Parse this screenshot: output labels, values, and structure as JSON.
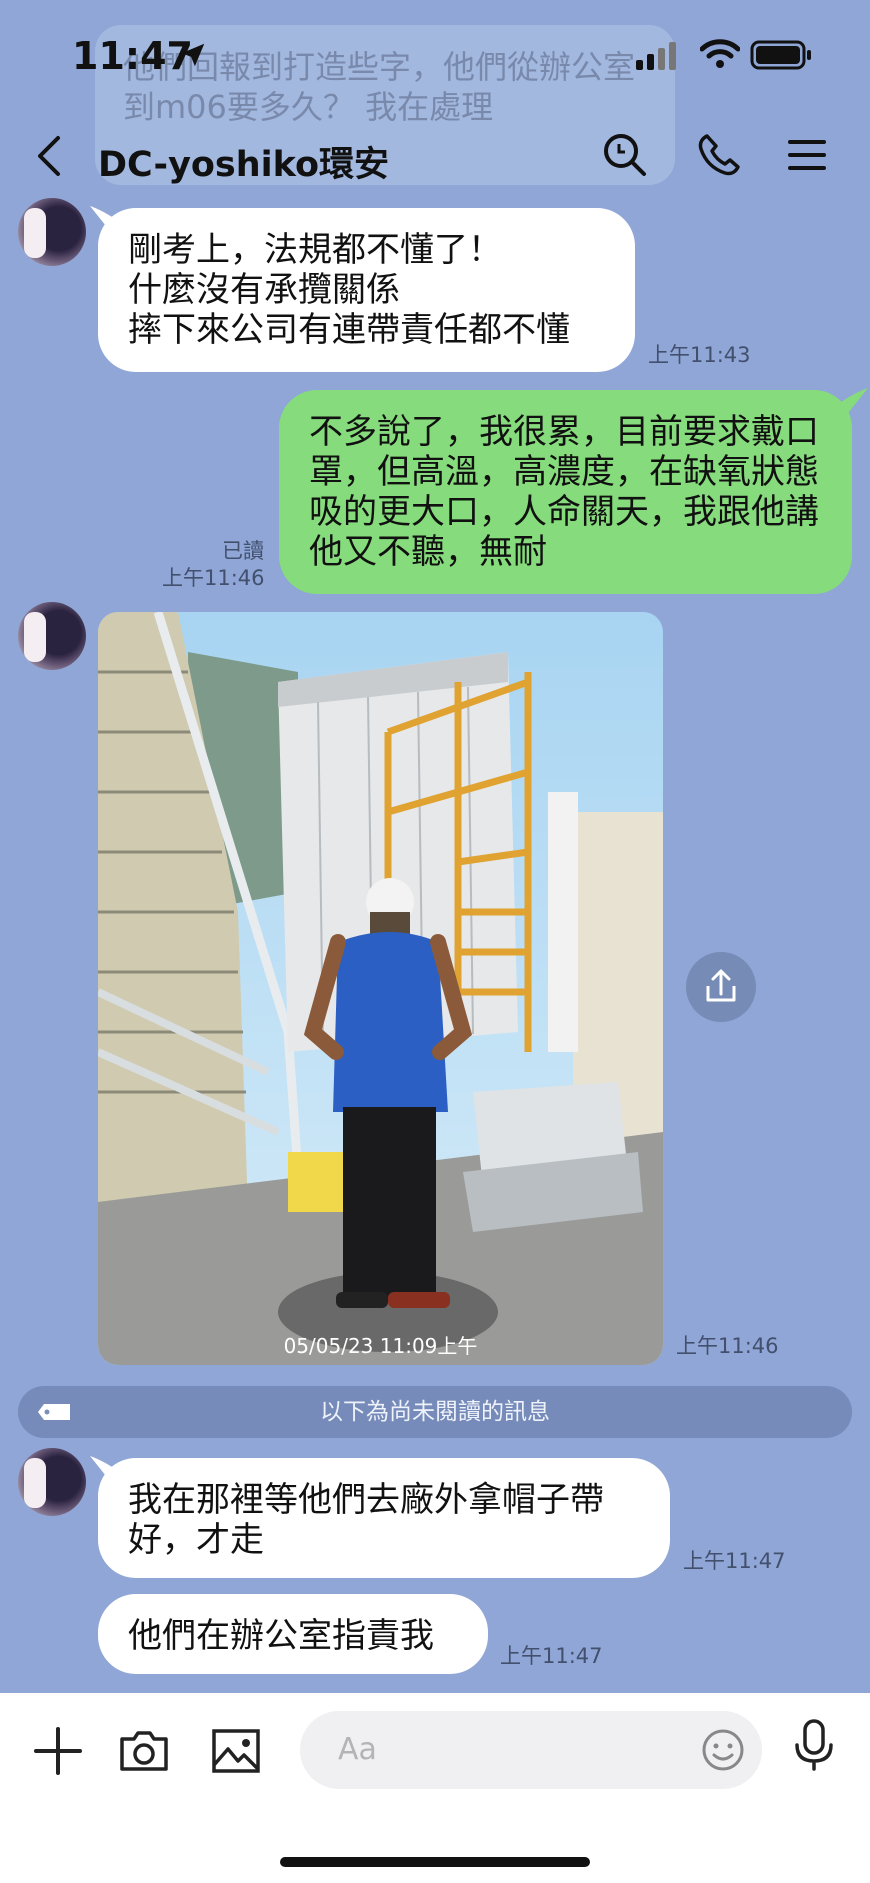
{
  "status_bar": {
    "time": "11:47"
  },
  "header": {
    "title": "DC-yoshiko環安"
  },
  "background_message": {
    "text": "他們回報到打造些字，他們從辦公室到m06要多久？\n我在處理"
  },
  "messages": [
    {
      "side": "in",
      "text": "剛考上，法規都不懂了！\n什麼沒有承攬關係\n摔下來公司有連帶責任都不懂",
      "time": "上午11:43"
    },
    {
      "side": "out",
      "text": "不多說了，我很累，目前要求戴口罩，但高溫，高濃度，在缺氧狀態吸的更大口，人命關天，我跟他講他又不聽，無耐",
      "read": "已讀",
      "time": "上午11:46"
    },
    {
      "side": "in",
      "type": "photo",
      "photo_stamp": "05/05/23 11:09上午",
      "time": "上午11:46"
    },
    {
      "side": "in",
      "text": "我在那裡等他們去廠外拿帽子帶好，才走",
      "time": "上午11:47"
    },
    {
      "side": "in",
      "text": "他們在辦公室指責我",
      "time": "上午11:47"
    }
  ],
  "unread_divider": "以下為尚未閱讀的訊息",
  "input": {
    "placeholder": "Aa"
  },
  "colors": {
    "background": "#8fa6d6",
    "outgoing_bubble": "#86dc7c",
    "incoming_bubble": "#ffffff"
  }
}
